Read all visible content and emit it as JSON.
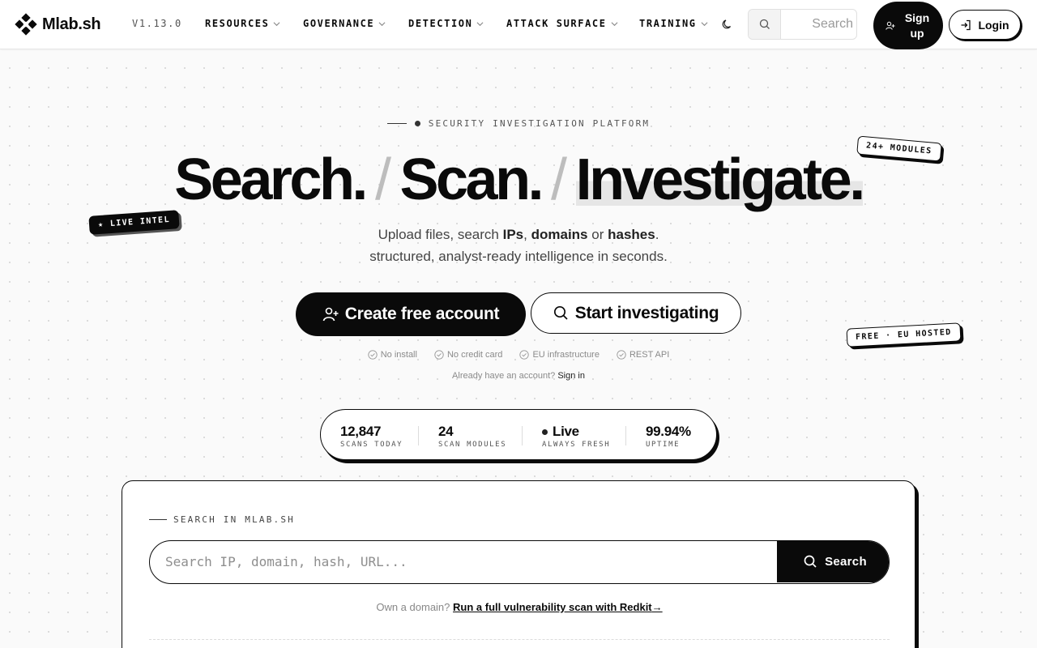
{
  "header": {
    "brand": "Mlab.sh",
    "version": "V1.13.0",
    "nav": [
      {
        "label": "RESOURCES"
      },
      {
        "label": "GOVERNANCE"
      },
      {
        "label": "DETECTION"
      },
      {
        "label": "ATTACK SURFACE"
      },
      {
        "label": "TRAINING"
      }
    ],
    "search_placeholder": "Search",
    "signup_label": "Sign up",
    "login_label": "Login"
  },
  "hero": {
    "eyebrow": "SECURITY INVESTIGATION PLATFORM",
    "headline_1": "Search.",
    "headline_2": "Scan.",
    "headline_3": "Investigate.",
    "separator": "/",
    "badges": {
      "modules": "24+ MODULES",
      "live": "★ LIVE INTEL",
      "free": "FREE · EU HOSTED"
    },
    "sub_1_a": "Upload files, search",
    "sub_1_ips": "IPs",
    "sub_1_comma": ",",
    "sub_1_domains": "domains",
    "sub_1_or": "or",
    "sub_1_hashes": "hashes",
    "sub_1_period": ".",
    "sub_2": "structured, analyst-ready intelligence in seconds.",
    "cta_primary": "Create free account",
    "cta_secondary": "Start investigating",
    "features": [
      "No install",
      "No credit card",
      "EU infrastructure",
      "REST API"
    ],
    "signin_prompt": "Already have an account?",
    "signin_link": "Sign in"
  },
  "stats": [
    {
      "value": "12,847",
      "label": "SCANS TODAY"
    },
    {
      "value": "24",
      "label": "SCAN MODULES"
    },
    {
      "value": "Live",
      "label": "ALWAYS FRESH"
    },
    {
      "value": "99.94%",
      "label": "UPTIME"
    }
  ],
  "search_card": {
    "label": "SEARCH IN MLAB.SH",
    "placeholder": "Search IP, domain, hash, URL...",
    "button": "Search",
    "redkit_prompt": "Own a domain?",
    "redkit_link": "Run a full vulnerability scan with Redkit",
    "redkit_arrow": "→"
  },
  "colors": {
    "ink": "#0a0a0a",
    "background": "#fafafa",
    "muted": "#8a8a8a"
  }
}
